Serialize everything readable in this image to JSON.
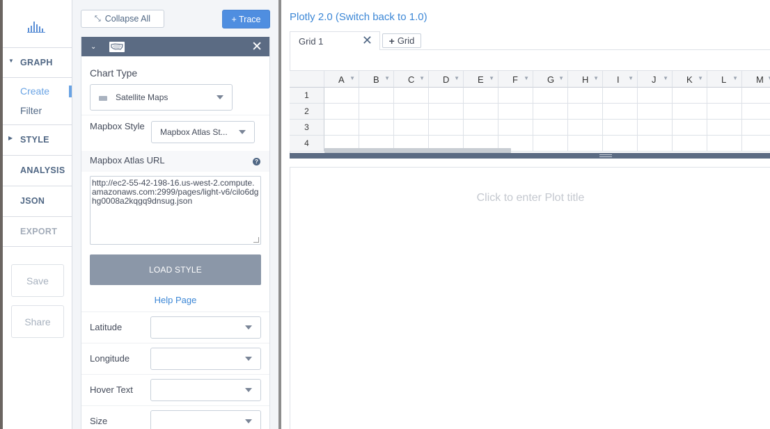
{
  "nav": {
    "graph": "GRAPH",
    "create": "Create",
    "filter": "Filter",
    "style": "STYLE",
    "analysis": "ANALYSIS",
    "json": "JSON",
    "export": "EXPORT",
    "save": "Save",
    "share": "Share"
  },
  "panel": {
    "collapse_all": "Collapse All",
    "add_trace": "+ Trace",
    "chart_type_label": "Chart Type",
    "chart_type_value": "Satellite Maps",
    "mapbox_style_label": "Mapbox Style",
    "mapbox_style_value": "Mapbox Atlas St...",
    "atlas_url_label": "Mapbox Atlas URL",
    "atlas_url_value": "http://ec2-55-42-198-16.us-west-2.compute.amazonaws.com:2999/pages/light-v6/cilo6dghg0008a2kqgq9dnsug.json",
    "load_style": "LOAD STYLE",
    "help_page": "Help Page",
    "fields": [
      {
        "label": "Latitude"
      },
      {
        "label": "Longitude"
      },
      {
        "label": "Hover Text"
      },
      {
        "label": "Size"
      }
    ]
  },
  "workspace": {
    "title": "Plotly 2.0 (Switch back to 1.0)",
    "tabs": [
      {
        "label": "Grid 1"
      }
    ],
    "add_grid": "Grid",
    "columns": [
      "A",
      "B",
      "C",
      "D",
      "E",
      "F",
      "G",
      "H",
      "I",
      "J",
      "K",
      "L",
      "M"
    ],
    "rows": [
      "1",
      "2",
      "3",
      "4"
    ],
    "plot_title_placeholder": "Click to enter Plot title"
  },
  "colors": {
    "accent": "#4f8ee0",
    "link": "#3c87d6",
    "trace_header": "#5b6b83",
    "load_button": "#8b97a8"
  }
}
